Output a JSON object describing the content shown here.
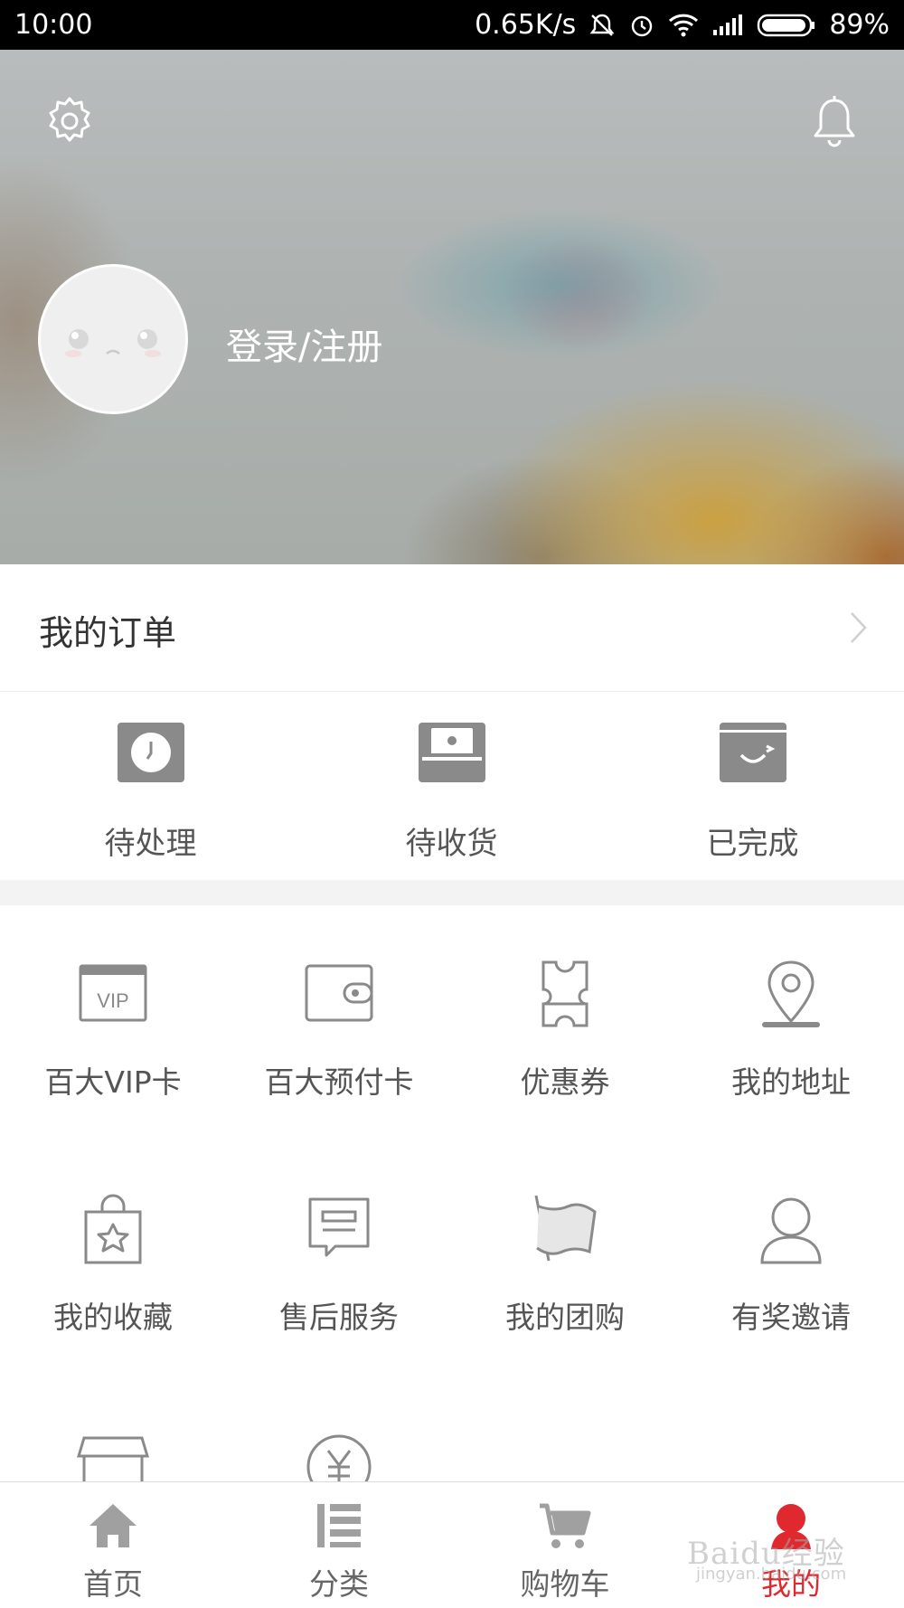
{
  "status_bar": {
    "time": "10:00",
    "network_speed": "0.65K/s",
    "battery": "89%",
    "icons": [
      "mute-icon",
      "alarm-icon",
      "wifi-icon",
      "signal-icon",
      "battery-icon"
    ]
  },
  "header": {
    "login_label": "登录/注册",
    "icons": [
      "gear-icon",
      "bell-icon"
    ]
  },
  "orders": {
    "title": "我的订单",
    "statuses": [
      {
        "label": "待处理",
        "icon": "pending-clock-icon"
      },
      {
        "label": "待收货",
        "icon": "receive-box-icon"
      },
      {
        "label": "已完成",
        "icon": "completed-smile-icon"
      }
    ]
  },
  "services": [
    {
      "label": "百大VIP卡",
      "icon": "vip-card-icon"
    },
    {
      "label": "百大预付卡",
      "icon": "wallet-icon"
    },
    {
      "label": "优惠券",
      "icon": "coupon-icon"
    },
    {
      "label": "我的地址",
      "icon": "location-pin-icon"
    },
    {
      "label": "我的收藏",
      "icon": "favorite-bag-icon"
    },
    {
      "label": "售后服务",
      "icon": "message-icon"
    },
    {
      "label": "我的团购",
      "icon": "flag-icon"
    },
    {
      "label": "有奖邀请",
      "icon": "person-icon"
    },
    {
      "label": "",
      "icon": "store-icon"
    },
    {
      "label": "",
      "icon": "yuan-coin-icon"
    }
  ],
  "bottom_nav": [
    {
      "label": "首页",
      "icon": "home-icon"
    },
    {
      "label": "分类",
      "icon": "category-list-icon"
    },
    {
      "label": "购物车",
      "icon": "cart-icon"
    },
    {
      "label": "我的",
      "icon": "profile-icon",
      "active": true
    }
  ],
  "watermark": {
    "text": "Baidu经验",
    "sub": "jingyan.baidu.com"
  },
  "colors": {
    "accent": "#e0282f",
    "icon_gray": "#888888"
  }
}
